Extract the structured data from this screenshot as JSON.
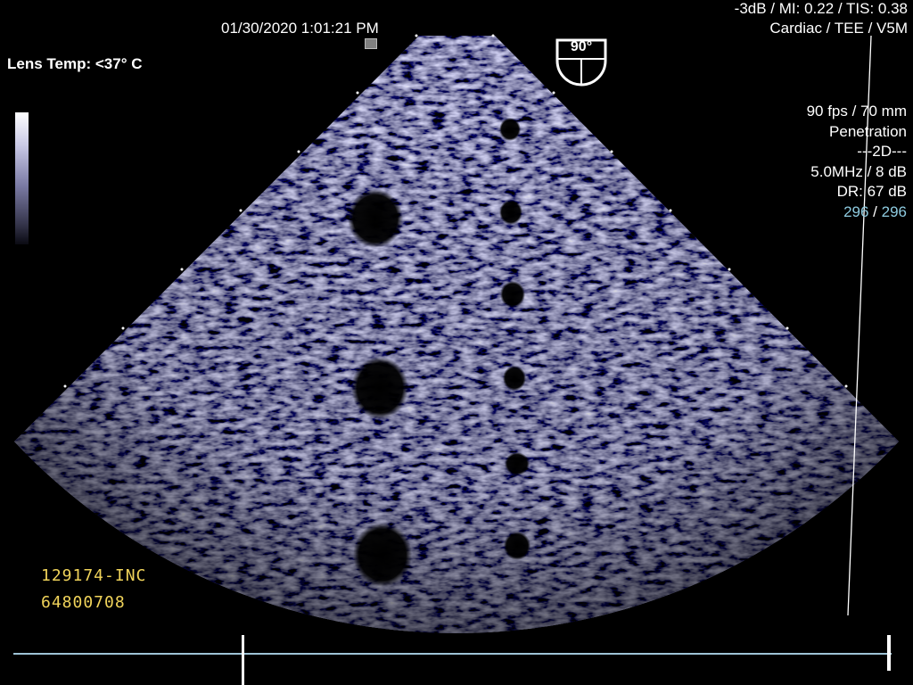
{
  "header": {
    "datetime": "01/30/2020 1:01:21 PM",
    "acoustic_output": "-3dB / MI: 0.22 / TIS: 0.38",
    "preset": "Cardiac / TEE / V5M",
    "lens_temp": "Lens Temp: <37° C"
  },
  "orientation": {
    "angle_label": "90°"
  },
  "imaging_params": {
    "frame_rate_depth": "90 fps / 70 mm",
    "mode_label": "Penetration",
    "mode": "---2D---",
    "freq_gain": "5.0MHz / 8 dB",
    "dynamic_range": "DR: 67 dB",
    "frame_current": "296",
    "frame_separator": " / ",
    "frame_total": "296"
  },
  "patient": {
    "id": "129174-INC",
    "accession": "64800708"
  },
  "colors": {
    "background": "#000000",
    "text": "#ffffff",
    "patient_text": "#f0d35a",
    "frame_counter": "#8ecbe0",
    "echo_tint": "#9a9ad0"
  }
}
